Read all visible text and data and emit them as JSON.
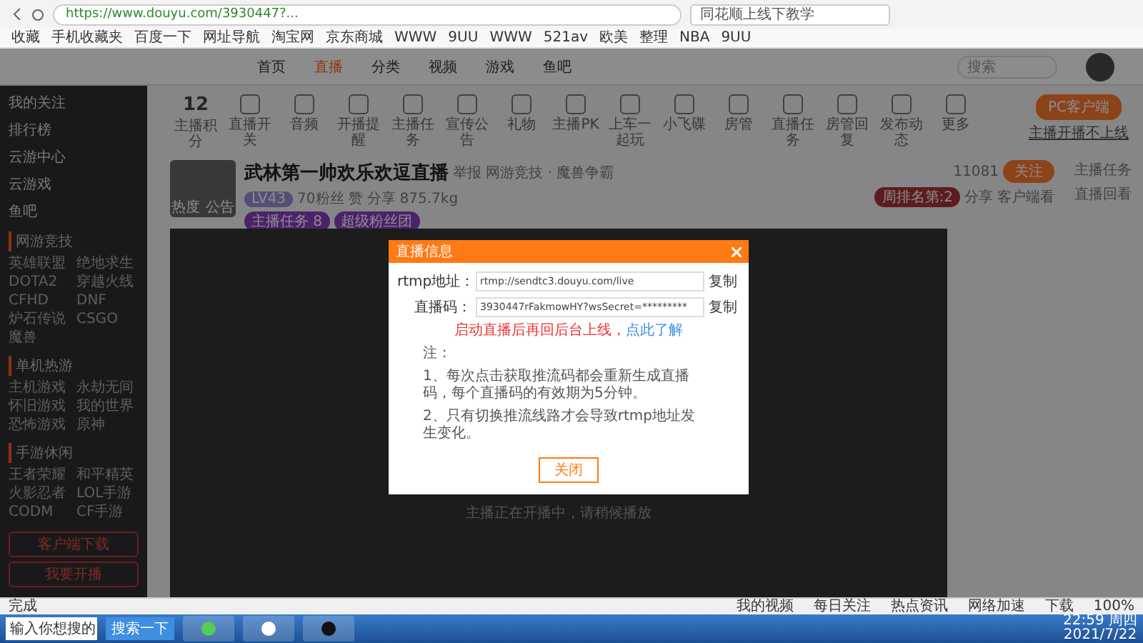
{
  "browser": {
    "url": "https://www.douyu.com/3930447?...",
    "search": "同花顺上线下教学",
    "bookmarks": [
      "收藏",
      "手机收藏夹",
      "百度一下",
      "网址导航",
      "淘宝网",
      "京东商城",
      "WWW",
      "9UU",
      "WWW",
      "521av",
      "欧美",
      "整理",
      "NBA",
      "9UU"
    ]
  },
  "site": {
    "nav": [
      {
        "label": "首页",
        "selected": false
      },
      {
        "label": "直播",
        "selected": true
      },
      {
        "label": "分类",
        "selected": false
      },
      {
        "label": "视频",
        "selected": false
      },
      {
        "label": "游戏",
        "selected": false
      },
      {
        "label": "鱼吧",
        "selected": false
      }
    ],
    "search": "搜索"
  },
  "sidebar": {
    "items": [
      "我的关注",
      "排行榜",
      "云游中心",
      "云游戏",
      "鱼吧"
    ],
    "sections": [
      {
        "title": "网游竞技",
        "items": [
          "英雄联盟",
          "绝地求生",
          "DOTA2",
          "穿越火线",
          "CFHD",
          "DNF",
          "炉石传说",
          "CSGO",
          "魔兽"
        ]
      },
      {
        "title": "单机热游",
        "items": [
          "主机游戏",
          "永劫无间",
          "怀旧游戏",
          "我的世界",
          "恐怖游戏",
          "原神"
        ]
      },
      {
        "title": "手游休闲",
        "items": [
          "王者荣耀",
          "和平精英",
          "火影忍者",
          "LOL手游",
          "CODM",
          "CF手游"
        ]
      }
    ],
    "buttons": [
      "客户端下载",
      "我要开播"
    ]
  },
  "toolbar": {
    "score": "12",
    "score_label": "主播积分",
    "tools": [
      "直播开关",
      "音频",
      "开播提醒",
      "主播任务",
      "宣传公告",
      "礼物",
      "主播PK",
      "上车一起玩",
      "小飞碟",
      "房管",
      "直播任务",
      "房管回复",
      "发布动态",
      "更多"
    ],
    "client_button": "PC客户端",
    "client_link": "主播开播不上线"
  },
  "room": {
    "title": "武林第一帅欢乐欢逗直播",
    "meta": "举报  网游竞技 · 魔兽争霸",
    "level": "LV43",
    "stats": [
      "70粉丝",
      "赞",
      "分享",
      "875.7kg"
    ],
    "badges": [
      "主播任务 8",
      "超级粉丝团"
    ],
    "cover_labels": [
      "热度",
      "公告"
    ],
    "follow_count": "11081",
    "follow": "关注",
    "right_links": [
      "主播任务",
      "直播回看"
    ],
    "rank": "周排名第:2",
    "actions": [
      "分享",
      "客户端看"
    ],
    "video_caption": "主播正在开播中，请稍候播放"
  },
  "dialog": {
    "title": "直播信息",
    "fields": [
      {
        "label": "rtmp地址：",
        "value": "rtmp://sendtc3.douyu.com/live",
        "action": "复制"
      },
      {
        "label": "直播码：",
        "value": "3930447rFakmowHY?wsSecret=*********",
        "action": "复制"
      }
    ],
    "warning": "启动直播后再回后台上线，",
    "link": "点此了解",
    "notes": [
      "注：",
      "1、每次点击获取推流码都会重新生成直播码，每个直播码的有效期为5分钟。",
      "2、只有切换推流线路才会导致rtmp地址发生变化。"
    ],
    "close_button": "关闭"
  },
  "status_bar": {
    "left": "完成",
    "items": [
      "我的视频",
      "每日关注",
      "热点资讯",
      "网络加速",
      "下载",
      "100%"
    ]
  },
  "taskbar": {
    "search": "输入你想搜的",
    "search_button": "搜索一下",
    "time": "22:59 周四",
    "date": "2021/7/22"
  }
}
